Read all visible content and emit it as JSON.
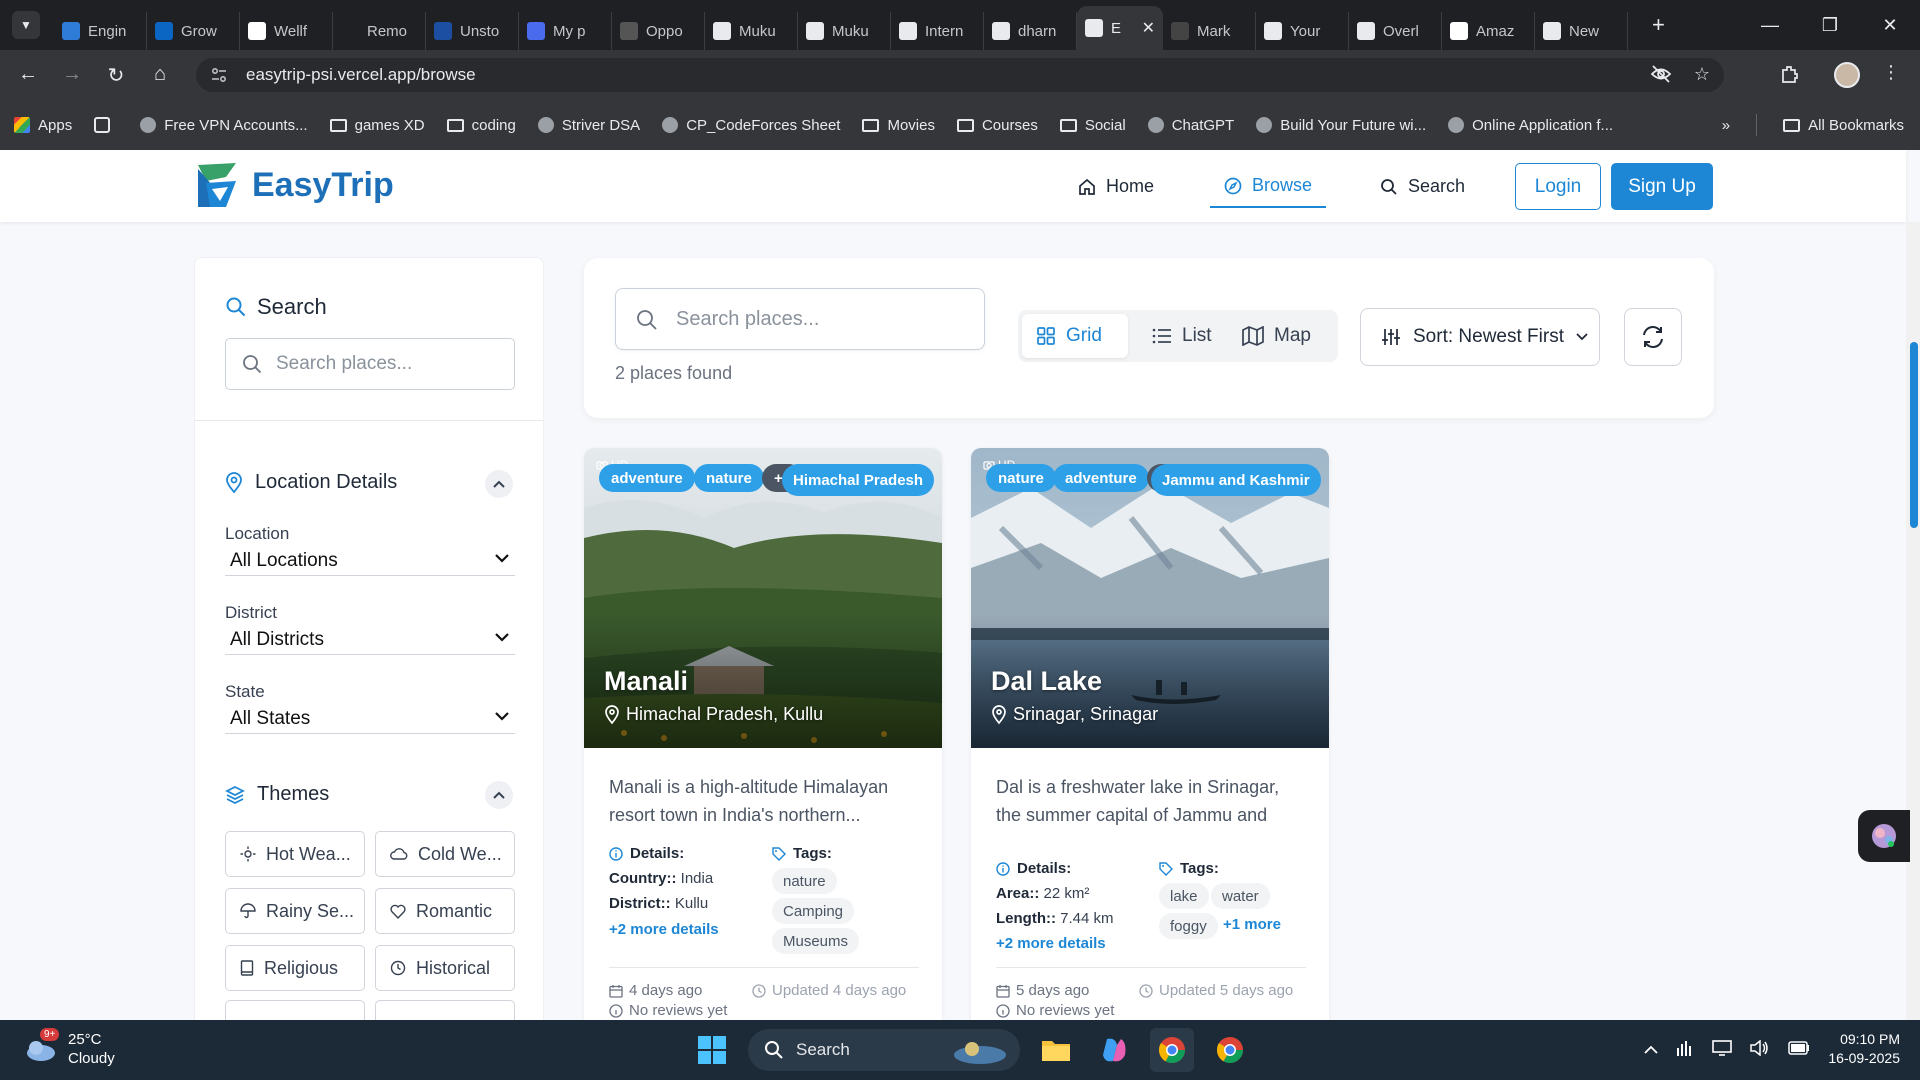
{
  "browser": {
    "tabs": [
      {
        "label": "Engin",
        "icon": "interviewbit-icon",
        "color": "#2f7bd8"
      },
      {
        "label": "Grow",
        "icon": "linkedin-icon",
        "color": "#0a66c2"
      },
      {
        "label": "Wellf",
        "icon": "wellfound-icon",
        "color": "#ffffff"
      },
      {
        "label": "Remo",
        "icon": "remoteok-icon",
        "color": "#1f2023"
      },
      {
        "label": "Unsto",
        "icon": "unstop-icon",
        "color": "#1c4fa1"
      },
      {
        "label": "My p",
        "icon": "kaggle-icon",
        "color": "#4b6bef"
      },
      {
        "label": "Oppo",
        "icon": "internshala-icon",
        "color": "#555"
      },
      {
        "label": "Muku",
        "icon": "github-icon",
        "color": "#e8eaed"
      },
      {
        "label": "Muku",
        "icon": "github-icon",
        "color": "#e8eaed"
      },
      {
        "label": "Intern",
        "icon": "openai-icon",
        "color": "#e8eaed"
      },
      {
        "label": "dharn",
        "icon": "github-icon",
        "color": "#e8eaed"
      },
      {
        "label": "E",
        "icon": "vercel-icon",
        "color": "#e8eaed",
        "active": true
      },
      {
        "label": "Mark",
        "icon": "markdown-icon",
        "color": "#444"
      },
      {
        "label": "Your",
        "icon": "github-icon",
        "color": "#e8eaed"
      },
      {
        "label": "Overl",
        "icon": "overleaf-icon",
        "color": "#e8eaed"
      },
      {
        "label": "Amaz",
        "icon": "amazon-icon",
        "color": "#ffffff"
      },
      {
        "label": "New",
        "icon": "chrome-icon",
        "color": "#e8eaed"
      }
    ],
    "url": "easytrip-psi.vercel.app/browse",
    "bookmarks": [
      {
        "label": "Apps",
        "icon": "apps-grid-icon"
      },
      {
        "label": "",
        "icon": "tab-groups-icon"
      },
      {
        "label": "Free VPN Accounts...",
        "icon": "vpn-site-icon"
      },
      {
        "label": "games XD",
        "icon": "folder-icon"
      },
      {
        "label": "coding",
        "icon": "folder-icon"
      },
      {
        "label": "Striver DSA",
        "icon": "striver-icon"
      },
      {
        "label": "CP_CodeForces Sheet",
        "icon": "codeforces-icon"
      },
      {
        "label": "Movies",
        "icon": "folder-icon"
      },
      {
        "label": "Courses",
        "icon": "folder-icon"
      },
      {
        "label": "Social",
        "icon": "folder-icon"
      },
      {
        "label": "ChatGPT",
        "icon": "openai-icon"
      },
      {
        "label": "Build Your Future wi...",
        "icon": "globe-icon"
      },
      {
        "label": "Online Application f...",
        "icon": "form-icon"
      }
    ],
    "all_bookmarks": "All Bookmarks"
  },
  "site": {
    "brand": "EasyTrip",
    "brand_color": "#1d6fb8",
    "accent": "#1d87d6",
    "nav": {
      "home": "Home",
      "browse": "Browse",
      "search": "Search"
    },
    "login": "Login",
    "signup": "Sign Up"
  },
  "sidebar": {
    "search_title": "Search",
    "search_placeholder": "Search places...",
    "location_title": "Location Details",
    "location_label": "Location",
    "location_value": "All Locations",
    "district_label": "District",
    "district_value": "All Districts",
    "state_label": "State",
    "state_value": "All States",
    "themes_title": "Themes",
    "themes": [
      {
        "label": "Hot Wea...",
        "icon": "sun-icon"
      },
      {
        "label": "Cold We...",
        "icon": "cloud-icon"
      },
      {
        "label": "Rainy Se...",
        "icon": "umbrella-icon"
      },
      {
        "label": "Romantic",
        "icon": "heart-icon"
      },
      {
        "label": "Religious",
        "icon": "book-icon"
      },
      {
        "label": "Historical",
        "icon": "clock-icon"
      }
    ]
  },
  "toolbar": {
    "search_placeholder": "Search places...",
    "results": "2 places found",
    "views": [
      "Grid",
      "List",
      "Map"
    ],
    "active_view": "Grid",
    "sort": "Sort: Newest First"
  },
  "cards": [
    {
      "title": "Manali",
      "location": "Himachal Pradesh, Kullu",
      "state": "Himachal Pradesh",
      "hd": "HD",
      "badges": [
        "adventure",
        "nature",
        "+1"
      ],
      "description": "Manali is a high-altitude Himalayan resort town in India's northern...",
      "details_title": "Details:",
      "details": [
        {
          "k": "Country::",
          "v": "India"
        },
        {
          "k": "District::",
          "v": "Kullu"
        }
      ],
      "details_more": "+2 more details",
      "tags_title": "Tags:",
      "tags": [
        "nature",
        "Camping",
        "Museums"
      ],
      "tags_more": "",
      "created": "4 days ago",
      "updated": "Updated 4 days ago",
      "reviews": "No reviews yet"
    },
    {
      "title": "Dal Lake",
      "location": "Srinagar, Srinagar",
      "state": "Jammu and Kashmir",
      "hd": "HD",
      "badges": [
        "nature",
        "adventure",
        "+1"
      ],
      "description": "Dal is a freshwater lake in Srinagar, the summer capital of Jammu and Kashmi...",
      "details_title": "Details:",
      "details": [
        {
          "k": "Area::",
          "v": "22 km²"
        },
        {
          "k": "Length::",
          "v": "7.44 km"
        }
      ],
      "details_more": "+2 more details",
      "tags_title": "Tags:",
      "tags": [
        "lake",
        "water",
        "foggy"
      ],
      "tags_more": "+1 more",
      "created": "5 days ago",
      "updated": "Updated 5 days ago",
      "reviews": "No reviews yet"
    }
  ],
  "taskbar": {
    "temp": "25°C",
    "weather": "Cloudy",
    "weather_badge": "9+",
    "search": "Search",
    "time": "09:10 PM",
    "date": "16-09-2025"
  }
}
